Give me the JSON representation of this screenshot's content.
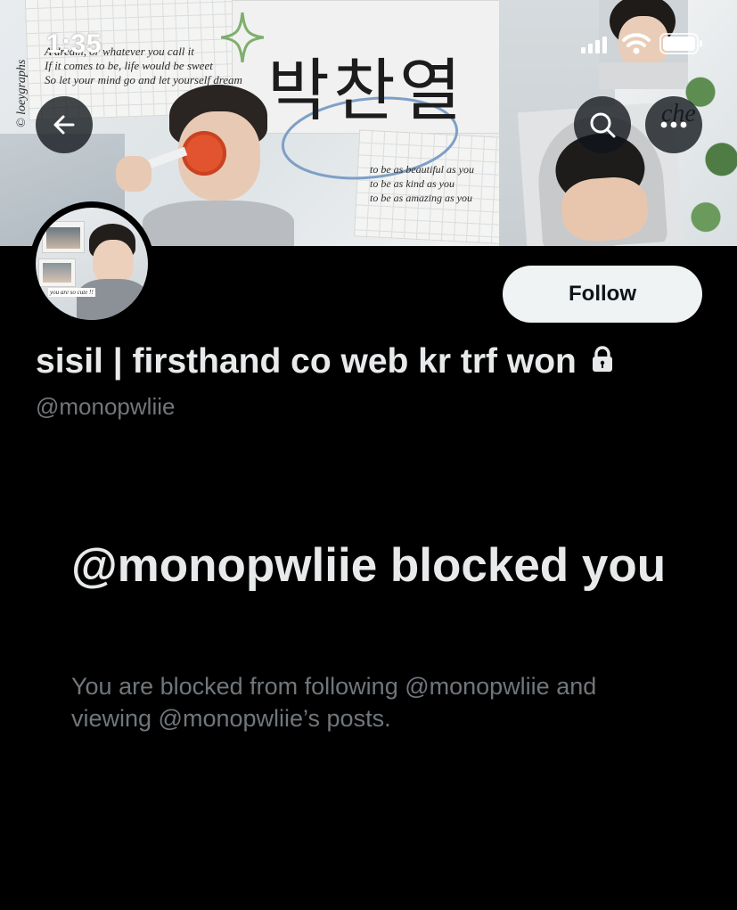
{
  "status_bar": {
    "time": "1:35",
    "icons": [
      "signal-icon",
      "wifi-icon",
      "battery-icon"
    ]
  },
  "banner": {
    "hangul_text": "박찬열",
    "credit": "© loeygraphs",
    "quote_lines": [
      "A dream, or whatever you call it",
      "If it comes to be, life would be sweet",
      "So let your mind go and let yourself dream"
    ],
    "poem_lines": [
      "to be as beautiful as you",
      "to be as kind as you",
      "to be as amazing as you"
    ],
    "corner_text": "che"
  },
  "header_actions": {
    "back_icon": "back-arrow-icon",
    "search_icon": "search-icon",
    "more_icon": "more-icon"
  },
  "avatar": {
    "caption": "you are so cute !!"
  },
  "profile": {
    "display_name": "sisil | firsthand co web kr trf won",
    "handle": "@monopwliie",
    "protected_icon": "lock-icon",
    "follow_label": "Follow"
  },
  "blocked": {
    "title": "@monopwliie blocked you",
    "description": "You are blocked from following @monopwliie and viewing @monopwliie’s posts."
  },
  "colors": {
    "background": "#000000",
    "primary_text": "#e7e9ea",
    "secondary_text": "#71767b",
    "follow_button_bg": "#eff3f4",
    "follow_button_text": "#0f1419"
  }
}
